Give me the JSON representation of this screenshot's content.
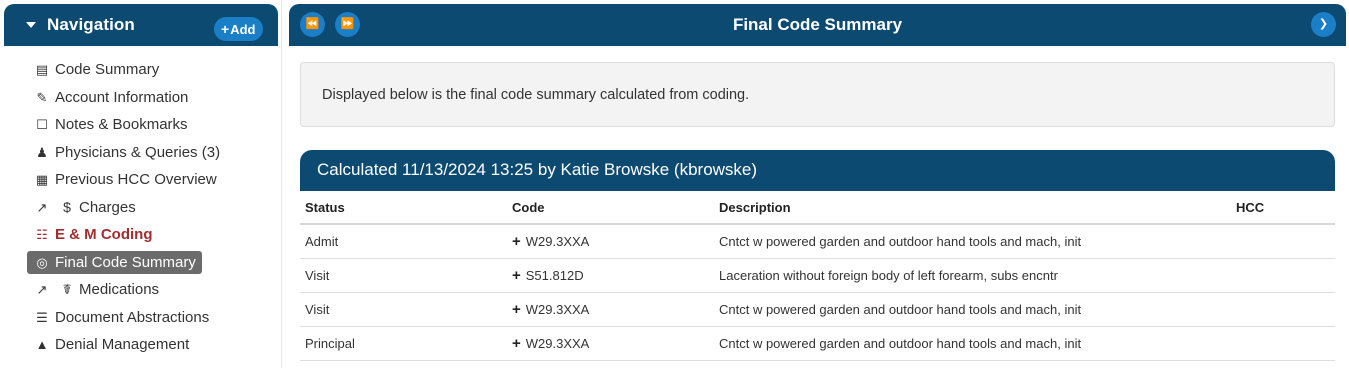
{
  "sidebar": {
    "title": "Navigation",
    "add_label": "Add",
    "items": [
      {
        "label": "Code Summary",
        "icon": "▤"
      },
      {
        "label": "Account Information",
        "icon": "✎"
      },
      {
        "label": "Notes & Bookmarks",
        "icon": "☐"
      },
      {
        "label": "Physicians & Queries (3)",
        "icon": "♟"
      },
      {
        "label": "Previous HCC Overview",
        "icon": "▦"
      },
      {
        "label": "Charges",
        "icon": "↗",
        "icon2": "$"
      },
      {
        "label": "E & M Coding",
        "icon": "☷"
      },
      {
        "label": "Final Code Summary",
        "icon": "◎"
      },
      {
        "label": "Medications",
        "icon": "↗",
        "icon2": "☤"
      },
      {
        "label": "Document Abstractions",
        "icon": "☰"
      },
      {
        "label": "Denial Management",
        "icon": "▲"
      }
    ]
  },
  "header": {
    "title": "Final Code Summary",
    "first_icon": "⏪",
    "prev_icon": "⏩",
    "next_icon": "❯"
  },
  "info": {
    "text": "Displayed below is the final code summary calculated from coding."
  },
  "panel": {
    "title": "Calculated 11/13/2024 13:25 by Katie Browske (kbrowske)"
  },
  "table": {
    "columns": [
      "Status",
      "Code",
      "Description",
      "HCC"
    ],
    "rows": [
      {
        "status": "Admit",
        "code": "W29.3XXA",
        "description": "Cntct w powered garden and outdoor hand tools and mach, init",
        "hcc": ""
      },
      {
        "status": "Visit",
        "code": "S51.812D",
        "description": "Laceration without foreign body of left forearm, subs encntr",
        "hcc": ""
      },
      {
        "status": "Visit",
        "code": "W29.3XXA",
        "description": "Cntct w powered garden and outdoor hand tools and mach, init",
        "hcc": ""
      },
      {
        "status": "Principal",
        "code": "W29.3XXA",
        "description": "Cntct w powered garden and outdoor hand tools and mach, init",
        "hcc": ""
      }
    ]
  },
  "colors": {
    "header_bg": "#0d4a72",
    "accent": "#1a7fc6",
    "alert": "#a12d2f",
    "active_bg": "#6b6b6b"
  }
}
